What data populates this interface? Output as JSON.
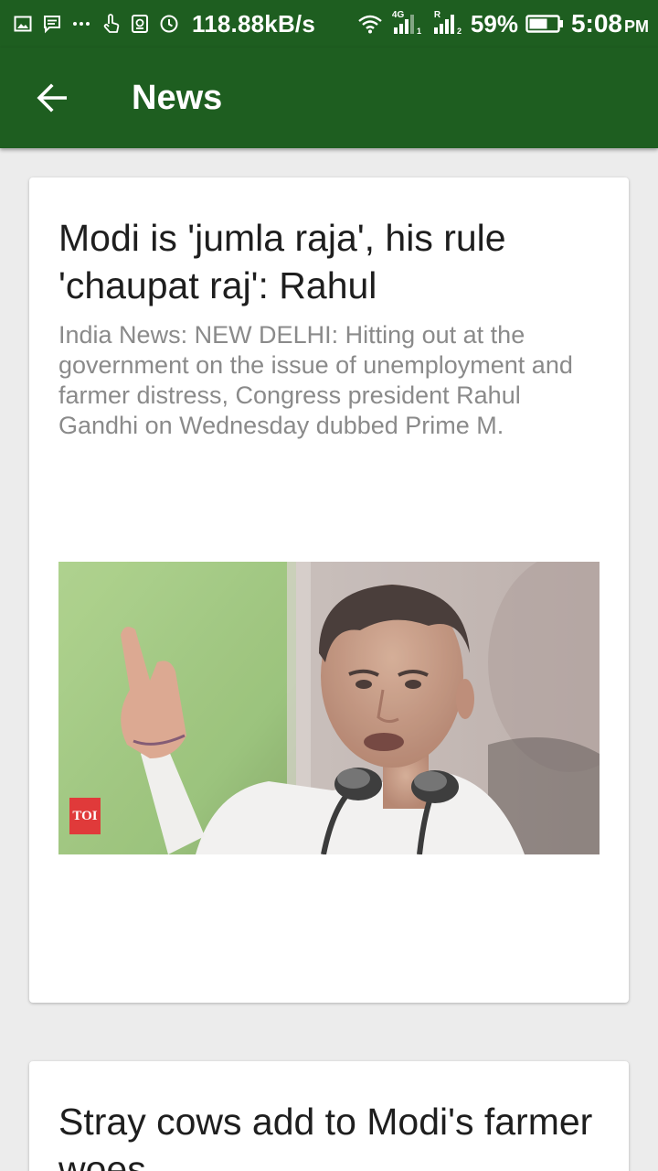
{
  "status_bar": {
    "net_speed": "118.88kB/s",
    "network_1": "4G",
    "network_2": "R",
    "battery_percent": "59%",
    "time": "5:08",
    "time_suffix": "PM"
  },
  "app_bar": {
    "title": "News",
    "back_icon": "arrow-left-icon"
  },
  "articles": [
    {
      "title": "Modi is 'jumla raja', his rule 'chaupat raj': Rahul",
      "description": "India News: NEW DELHI: Hitting out at the government on the issue of unemployment and farmer distress, Congress president Rahul Gandhi on Wednesday dubbed Prime M.",
      "image_badge": "TOI"
    },
    {
      "title": "Stray cows add to Modi's farmer woes"
    }
  ],
  "colors": {
    "app_bar": "#1e5e20",
    "background": "#ececec",
    "card": "#ffffff",
    "title_text": "#1e1e1e",
    "description_text": "#8a8a8a"
  }
}
